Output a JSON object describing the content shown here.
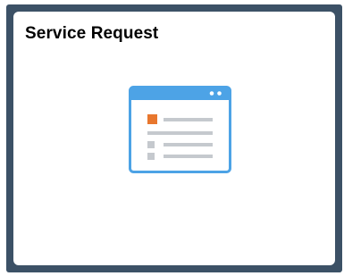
{
  "tile": {
    "title": "Service Request",
    "icon": "form-document-icon"
  },
  "colors": {
    "frame": "#3c5166",
    "tile_background": "#ffffff",
    "icon_blue": "#4da3e6",
    "icon_accent": "#e8772e",
    "icon_lines": "#c5c9ce"
  }
}
